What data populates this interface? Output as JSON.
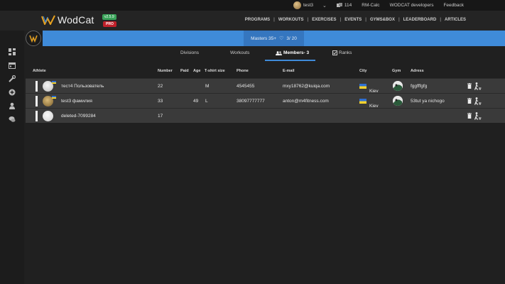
{
  "topbar": {
    "username": "test3",
    "coins": "114",
    "rm_calc": "RM-Calc",
    "developers": "WODCAT developers",
    "feedback": "Feedback"
  },
  "header": {
    "app_name": "WodCat",
    "version": "v2.5.9",
    "pro": "PRO",
    "nav": [
      "PROGRAMS",
      "WORKOUTS",
      "EXERCISES",
      "EVENTS",
      "GYMS&BOX",
      "LEADERBOARD",
      "ARTICLES"
    ]
  },
  "event": {
    "division_name": "Masters 35+",
    "count": "3/ 20"
  },
  "tabs": {
    "divisions": "Divisions",
    "workouts": "Workouts",
    "members": "Members- 3",
    "ranks": "Ranks"
  },
  "table": {
    "headers": {
      "athlete": "Athlete",
      "number": "Number",
      "paid": "Paid",
      "age": "Age",
      "tshirt": "T-shirt size",
      "phone": "Phone",
      "email": "E-mail",
      "city": "City",
      "gym": "Gym",
      "address": "Adress"
    },
    "rows": [
      {
        "athlete": "тест4 Пользователь",
        "number": "22",
        "paid": "",
        "age": "",
        "tshirt": "M",
        "phone": "4545455",
        "email": "mxy18762@kuiqa.com",
        "city": "Kiev",
        "address": "fggfffgfg"
      },
      {
        "athlete": "test3 фамилия",
        "number": "33",
        "paid": "",
        "age": "49",
        "tshirt": "L",
        "phone": "38097777777",
        "email": "anton@m4fitness.com",
        "city": "Kiev",
        "address": "53tut ya nichogo"
      },
      {
        "athlete": "deleted-7099284",
        "number": "17",
        "paid": "",
        "age": "",
        "tshirt": "",
        "phone": "",
        "email": "",
        "city": "",
        "address": ""
      }
    ]
  },
  "colors": {
    "banner": "#3f8bd9",
    "pro_badge": "#c0202a",
    "version_badge": "#3aa35a"
  },
  "icons": {
    "sidebar": [
      "dashboard-icon",
      "calendar-icon",
      "tools-icon",
      "add-circle-icon",
      "user-icon",
      "chat-icon"
    ]
  }
}
